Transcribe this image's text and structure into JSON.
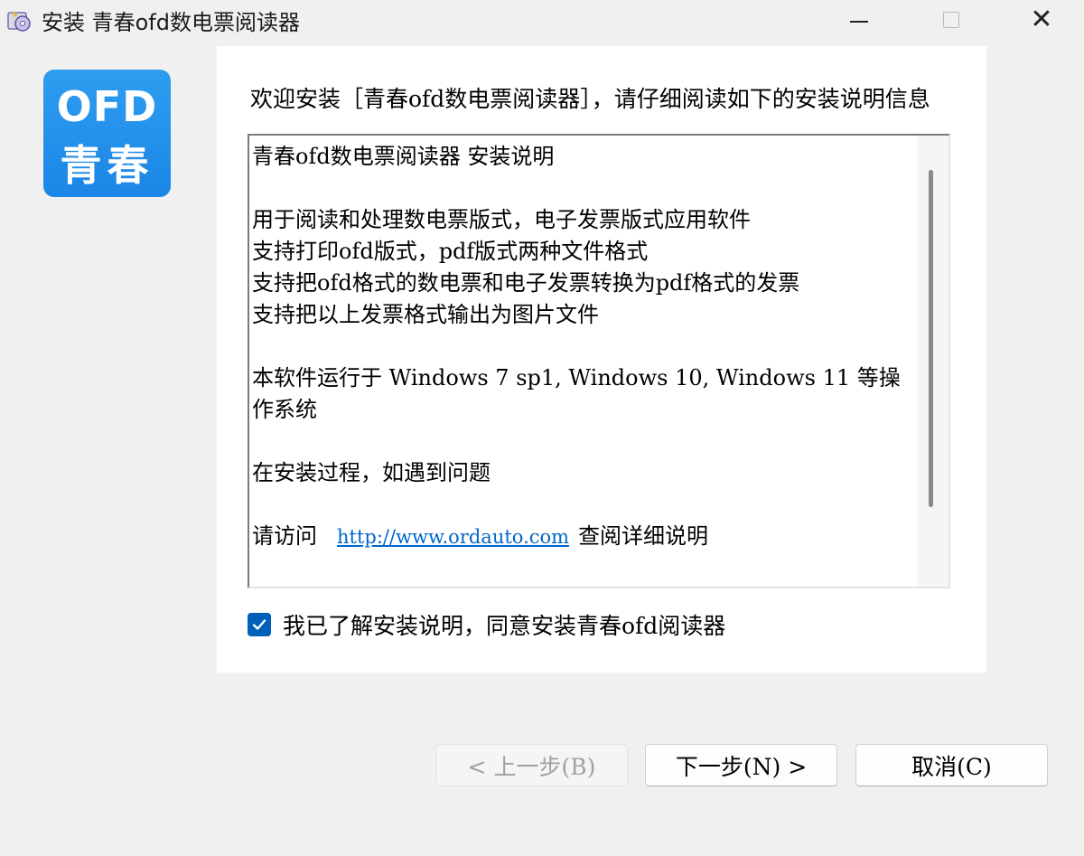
{
  "window": {
    "title": "安装 青春ofd数电票阅读器",
    "controls": [
      "minimize",
      "maximize",
      "close"
    ],
    "close_glyph": "✕"
  },
  "logo": {
    "top": "OFD",
    "bottom": "青春",
    "color": "#1b86e6"
  },
  "intro": "欢迎安装［青春ofd数电票阅读器］，请仔细阅读如下的安装说明信息",
  "readme": {
    "lines": [
      "青春ofd数电票阅读器 安装说明",
      "",
      "用于阅读和处理数电票版式，电子发票版式应用软件",
      "支持打印ofd版式，pdf版式两种文件格式",
      "支持把ofd格式的数电票和电子发票转换为pdf格式的发票",
      "支持把以上发票格式输出为图片文件",
      "",
      "本软件运行于 Windows 7 sp1, Windows 10, Windows 11 等操作系统",
      "",
      "在安装过程，如遇到问题",
      ""
    ],
    "visit_prefix": "请访问",
    "link": "http://www.ordauto.com",
    "visit_suffix": "查阅详细说明"
  },
  "agree": {
    "checked": true,
    "label": "我已了解安装说明，同意安装青春ofd阅读器",
    "accent": "#005fb8"
  },
  "buttons": {
    "back": "< 上一步(B)",
    "next": "下一步(N) >",
    "cancel": "取消(C)"
  }
}
